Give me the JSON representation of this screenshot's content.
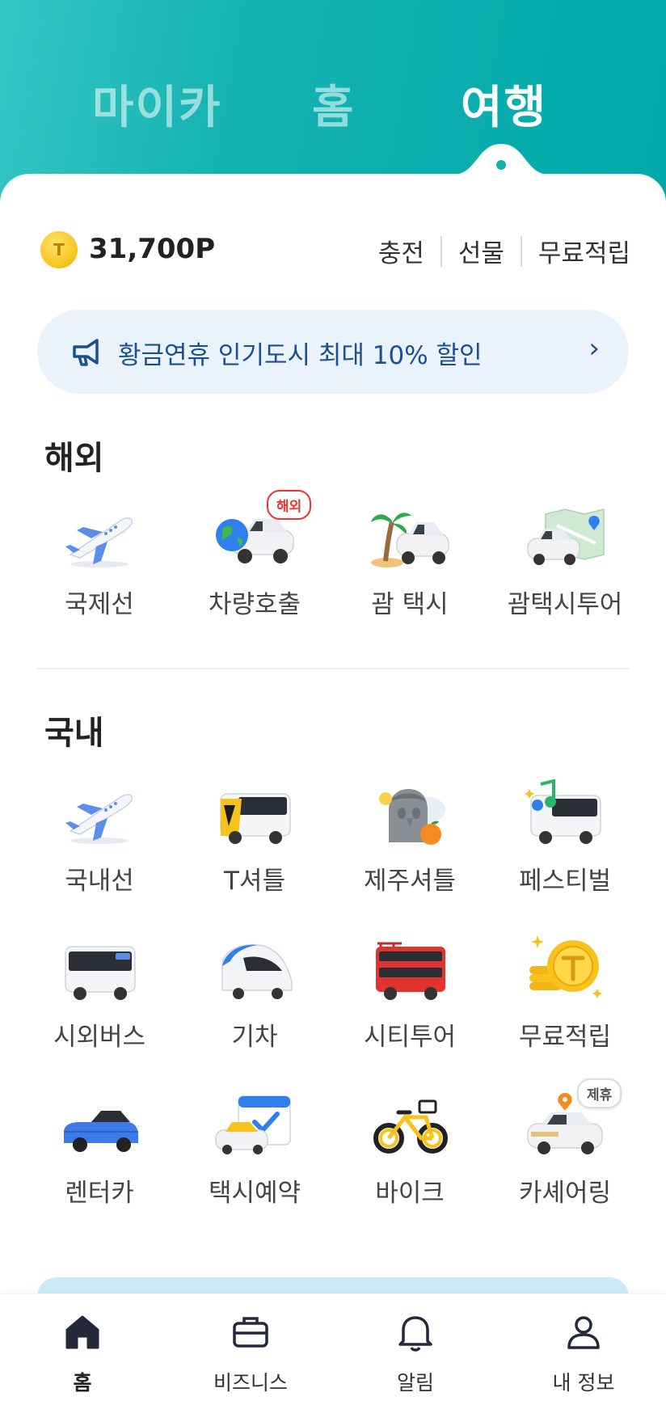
{
  "tabs": {
    "mycar": "마이카",
    "home": "홈",
    "travel": "여행"
  },
  "points": {
    "coin_symbol": "T",
    "amount": "31,700P",
    "links": [
      "충전",
      "선물",
      "무료적립"
    ]
  },
  "promo": {
    "text": "황금연휴 인기도시 최대 10% 할인",
    "chevron": "›"
  },
  "overseas": {
    "title": "해외",
    "items": [
      {
        "label": "국제선",
        "icon": "airplane-icon"
      },
      {
        "label": "차량호출",
        "icon": "globe-car-icon",
        "badge": "해외"
      },
      {
        "label": "괌 택시",
        "icon": "palm-car-icon"
      },
      {
        "label": "괌택시투어",
        "icon": "map-car-icon"
      }
    ]
  },
  "domestic": {
    "title": "국내",
    "items": [
      {
        "label": "국내선",
        "icon": "airplane-icon"
      },
      {
        "label": "T셔틀",
        "icon": "shuttle-bus-icon"
      },
      {
        "label": "제주셔틀",
        "icon": "jeju-stone-icon"
      },
      {
        "label": "페스티벌",
        "icon": "festival-bus-icon"
      },
      {
        "label": "시외버스",
        "icon": "intercity-bus-icon"
      },
      {
        "label": "기차",
        "icon": "train-icon"
      },
      {
        "label": "시티투어",
        "icon": "double-decker-icon"
      },
      {
        "label": "무료적립",
        "icon": "coin-stack-icon"
      },
      {
        "label": "렌터카",
        "icon": "convertible-icon"
      },
      {
        "label": "택시예약",
        "icon": "calendar-taxi-icon"
      },
      {
        "label": "바이크",
        "icon": "bike-icon"
      },
      {
        "label": "카셰어링",
        "icon": "carshare-icon",
        "badge": "제휴"
      }
    ]
  },
  "nav": [
    {
      "label": "홈",
      "icon": "home-icon"
    },
    {
      "label": "비즈니스",
      "icon": "briefcase-icon"
    },
    {
      "label": "알림",
      "icon": "bell-icon"
    },
    {
      "label": "내 정보",
      "icon": "person-icon"
    }
  ],
  "colors": {
    "header": "#14b3b1",
    "promo_bg": "#eaf3fb",
    "promo_text": "#1b4f91",
    "badge_red": "#e33333"
  }
}
